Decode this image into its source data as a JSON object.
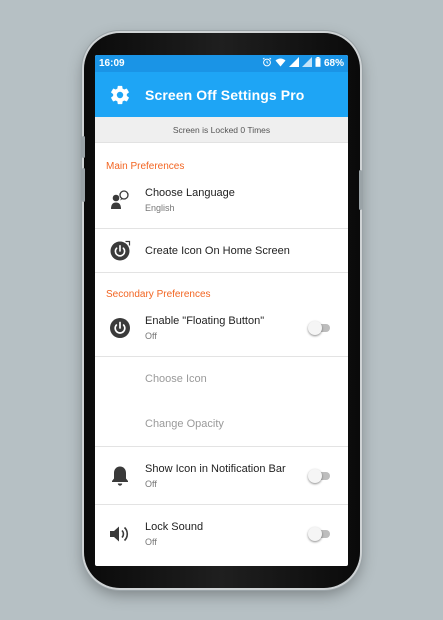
{
  "status_bar": {
    "time": "16:09",
    "battery": "68%"
  },
  "app_bar": {
    "title": "Screen Off Settings Pro"
  },
  "lock_info": "Screen is Locked 0 Times",
  "sections": {
    "main": "Main Preferences",
    "secondary": "Secondary Preferences"
  },
  "items": {
    "language": {
      "title": "Choose Language",
      "summary": "English"
    },
    "home_icon": {
      "title": "Create Icon On Home Screen"
    },
    "floating": {
      "title": "Enable \"Floating Button\"",
      "summary": "Off"
    },
    "choose_icon": {
      "title": "Choose Icon"
    },
    "opacity": {
      "title": "Change Opacity"
    },
    "notification": {
      "title": "Show Icon in Notification Bar",
      "summary": "Off"
    },
    "lock_sound": {
      "title": "Lock Sound",
      "summary": "Off"
    }
  },
  "colors": {
    "accent": "#1ea5f5",
    "status": "#1a94e6",
    "section": "#f26522"
  }
}
